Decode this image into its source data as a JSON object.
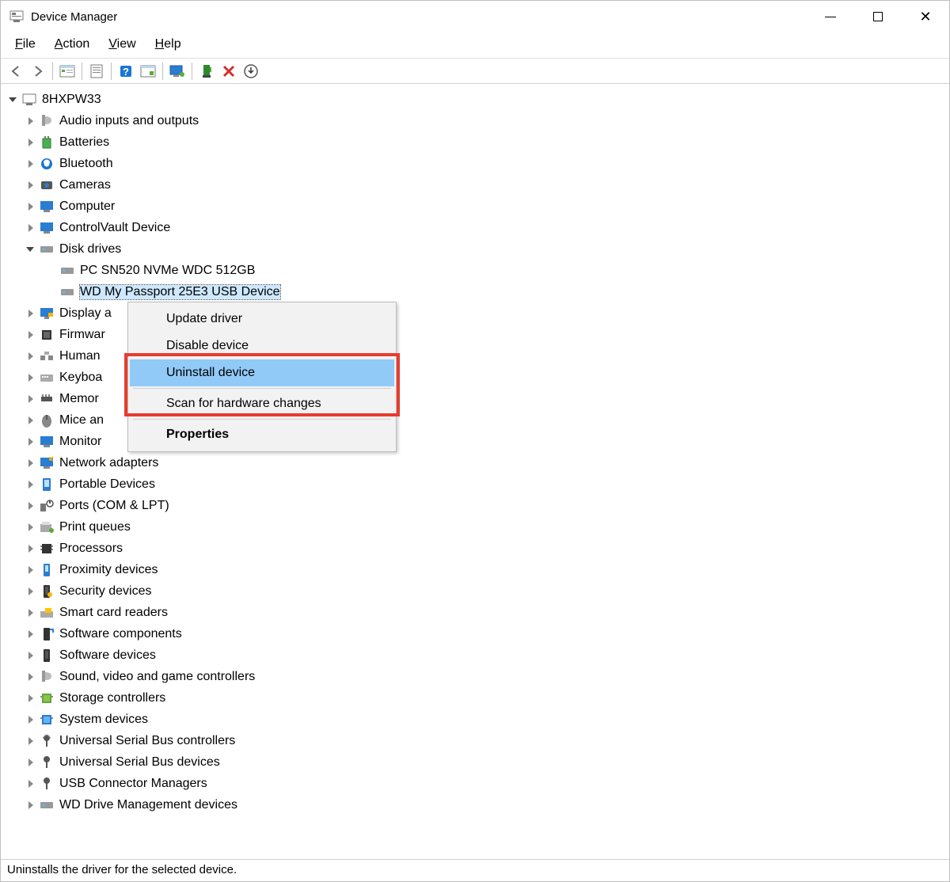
{
  "window": {
    "title": "Device Manager"
  },
  "menu": {
    "file": "File",
    "action": "Action",
    "view": "View",
    "help": "Help"
  },
  "toolbar_icons": {
    "back": "back-arrow",
    "forward": "forward-arrow",
    "show_hide": "show-hide-console-tree",
    "properties": "properties",
    "help": "help",
    "scan": "scan-hardware",
    "monitor": "update-driver",
    "enable": "enable-device",
    "uninstall": "uninstall",
    "legacy": "add-legacy"
  },
  "tree": {
    "root": "8HXPW33",
    "categories": [
      "Audio inputs and outputs",
      "Batteries",
      "Bluetooth",
      "Cameras",
      "Computer",
      "ControlVault Device",
      "Disk drives",
      "Display adapters",
      "Firmware",
      "Human Interface Devices",
      "Keyboards",
      "Memory technology devices",
      "Mice and other pointing devices",
      "Monitors",
      "Network adapters",
      "Portable Devices",
      "Ports (COM & LPT)",
      "Print queues",
      "Processors",
      "Proximity devices",
      "Security devices",
      "Smart card readers",
      "Software components",
      "Software devices",
      "Sound, video and game controllers",
      "Storage controllers",
      "System devices",
      "Universal Serial Bus controllers",
      "Universal Serial Bus devices",
      "USB Connector Managers",
      "WD Drive Management devices"
    ],
    "categories_truncated": {
      "7": "Display a",
      "8": "Firmwar",
      "9": "Human",
      "10": "Keyboa",
      "11": "Memor",
      "12": "Mice an",
      "13": "Monitor"
    },
    "disk_children": [
      "PC SN520 NVMe WDC 512GB",
      "WD My Passport 25E3 USB Device"
    ]
  },
  "context_menu": {
    "items": [
      "Update driver",
      "Disable device",
      "Uninstall device",
      "Scan for hardware changes",
      "Properties"
    ],
    "highlighted_index": 2,
    "bold_index": 4
  },
  "statusbar": {
    "text": "Uninstalls the driver for the selected device."
  }
}
